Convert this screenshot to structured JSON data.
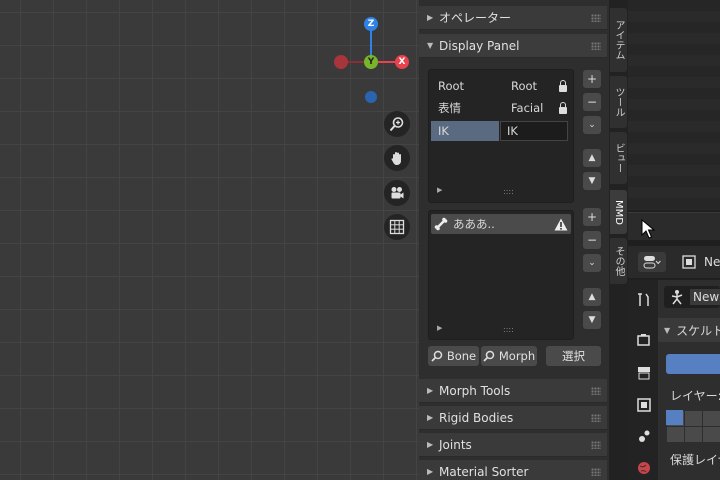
{
  "gizmo": {
    "z": "Z",
    "y": "Y",
    "x": "X"
  },
  "panels": {
    "operator": "オペレーター",
    "display_panel": "Display Panel",
    "morph_tools": "Morph Tools",
    "rigid_bodies": "Rigid Bodies",
    "joints": "Joints",
    "material_sorter": "Material Sorter"
  },
  "frames": [
    {
      "name": "Root",
      "value": "Root"
    },
    {
      "name": "表情",
      "value": "Facial"
    },
    {
      "name": "IK",
      "value": "IK"
    }
  ],
  "items": [
    {
      "name": "あああ.."
    }
  ],
  "buttons": {
    "bone": "Bone",
    "morph": "Morph",
    "select": "選択",
    "plus": "+",
    "minus": "−",
    "grip": "::::"
  },
  "tabs": [
    "アイテム",
    "ツール",
    "ビュー",
    "MMD",
    "その他"
  ],
  "properties": {
    "new_label": "New",
    "skeleton": "スケルト",
    "layer": "レイヤー:",
    "protect_layer": "保護レイヤ"
  },
  "colors": {
    "selected": "#5680c2",
    "x_axis": "#e8424e",
    "y_axis": "#77b52a",
    "z_axis": "#2f83e6"
  }
}
